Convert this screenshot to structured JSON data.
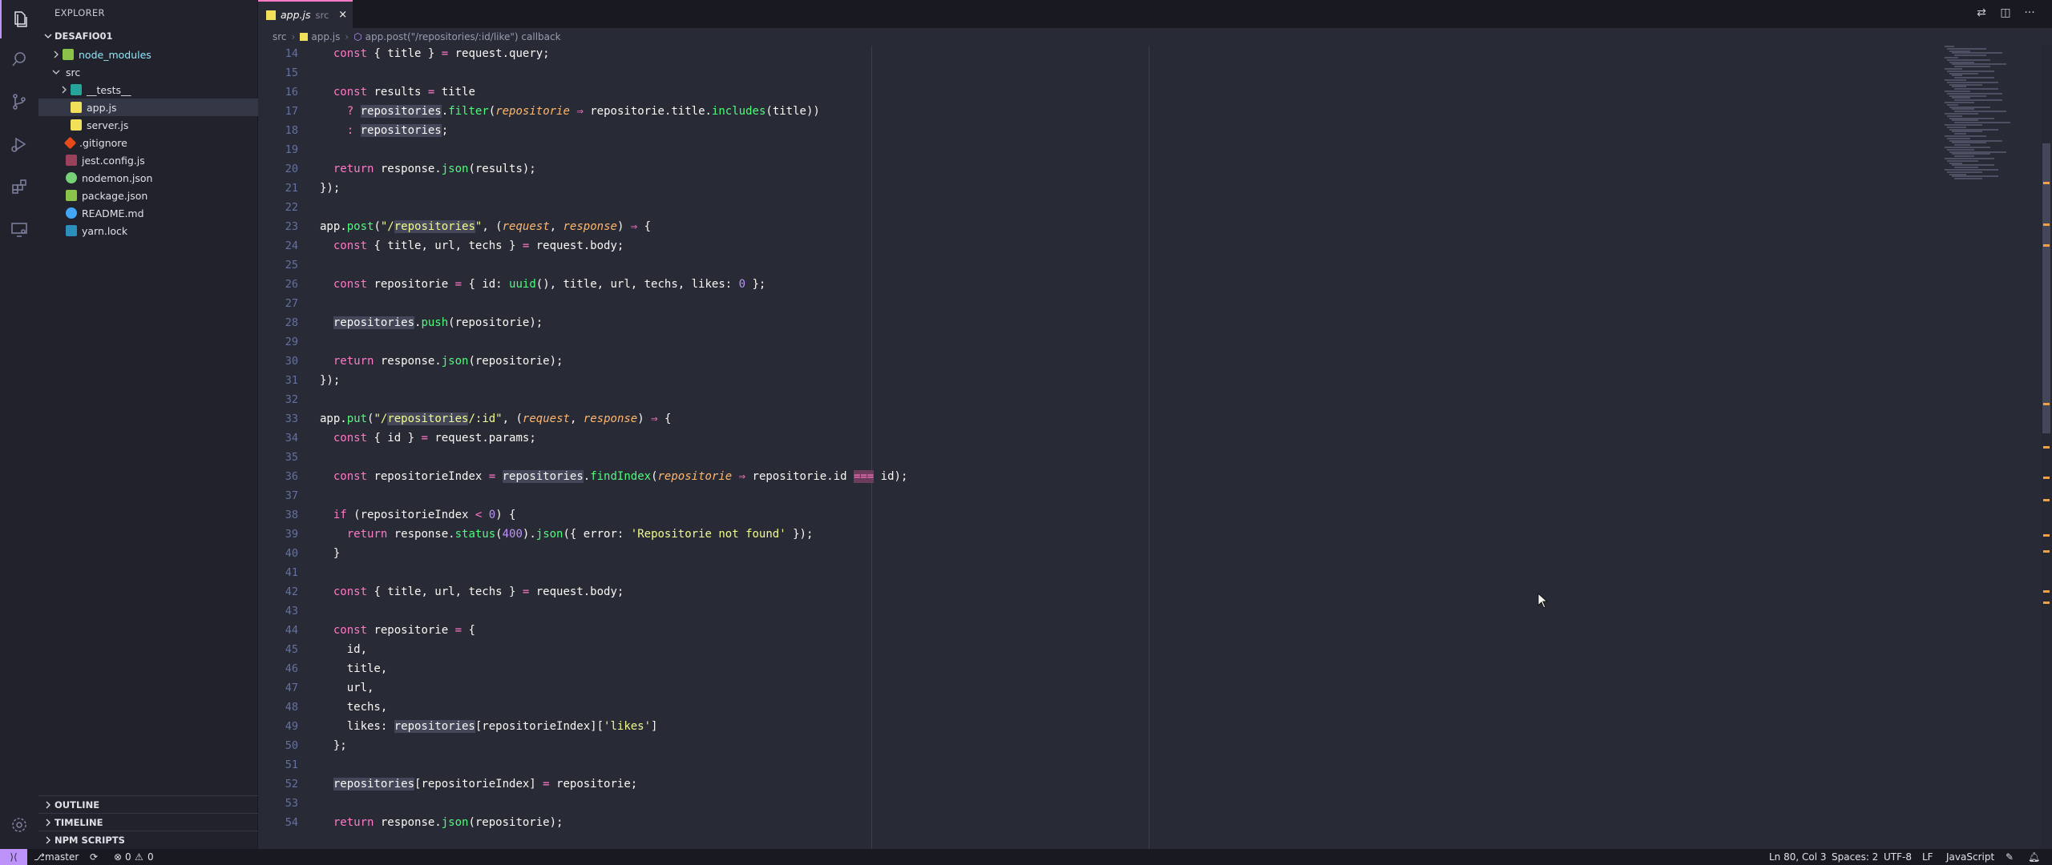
{
  "sidebar": {
    "title": "EXPLORER",
    "workspace": "DESAFIO01",
    "tree": [
      {
        "label": "node_modules",
        "kind": "folder",
        "color": "#8be9fd"
      },
      {
        "label": "src",
        "kind": "folder-open",
        "color": "#e0e0e6"
      },
      {
        "label": "__tests__",
        "kind": "folder",
        "color": "#e0e0e6"
      },
      {
        "label": "app.js",
        "kind": "js",
        "color": "#e0e0e6"
      },
      {
        "label": "server.js",
        "kind": "js",
        "color": "#e0e0e6"
      },
      {
        "label": ".gitignore",
        "kind": "git",
        "color": "#e0e0e6"
      },
      {
        "label": "jest.config.js",
        "kind": "jest",
        "color": "#e0e0e6"
      },
      {
        "label": "nodemon.json",
        "kind": "nodemon",
        "color": "#e0e0e6"
      },
      {
        "label": "package.json",
        "kind": "npm",
        "color": "#e0e0e6"
      },
      {
        "label": "README.md",
        "kind": "info",
        "color": "#e0e0e6"
      },
      {
        "label": "yarn.lock",
        "kind": "yarn",
        "color": "#e0e0e6"
      }
    ],
    "sections": [
      "OUTLINE",
      "TIMELINE",
      "NPM SCRIPTS"
    ]
  },
  "tab": {
    "name": "app.js",
    "desc": "src",
    "close": "×"
  },
  "breadcrumb": [
    "src",
    "app.js",
    "app.post(\"/repositories/:id/like\") callback"
  ],
  "editor": {
    "line_numbers": [
      "14",
      "15",
      "16",
      "17",
      "18",
      "19",
      "20",
      "21",
      "22",
      "23",
      "24",
      "25",
      "26",
      "27",
      "28",
      "29",
      "30",
      "31",
      "32",
      "33",
      "34",
      "35",
      "36",
      "37",
      "38",
      "39",
      "40",
      "41",
      "42",
      "43",
      "44",
      "45",
      "46",
      "47",
      "48",
      "49",
      "50",
      "51",
      "52",
      "53",
      "54"
    ]
  },
  "statusbar": {
    "branch": "master",
    "errors": "0",
    "warnings": "0",
    "position": "Ln 80, Col 3",
    "spaces": "Spaces: 2",
    "encoding": "UTF-8",
    "eol": "LF",
    "language": "JavaScript"
  },
  "colors": {
    "accent": "#bd93f9",
    "tab_border": "#ff79c6",
    "background": "#282a36"
  }
}
